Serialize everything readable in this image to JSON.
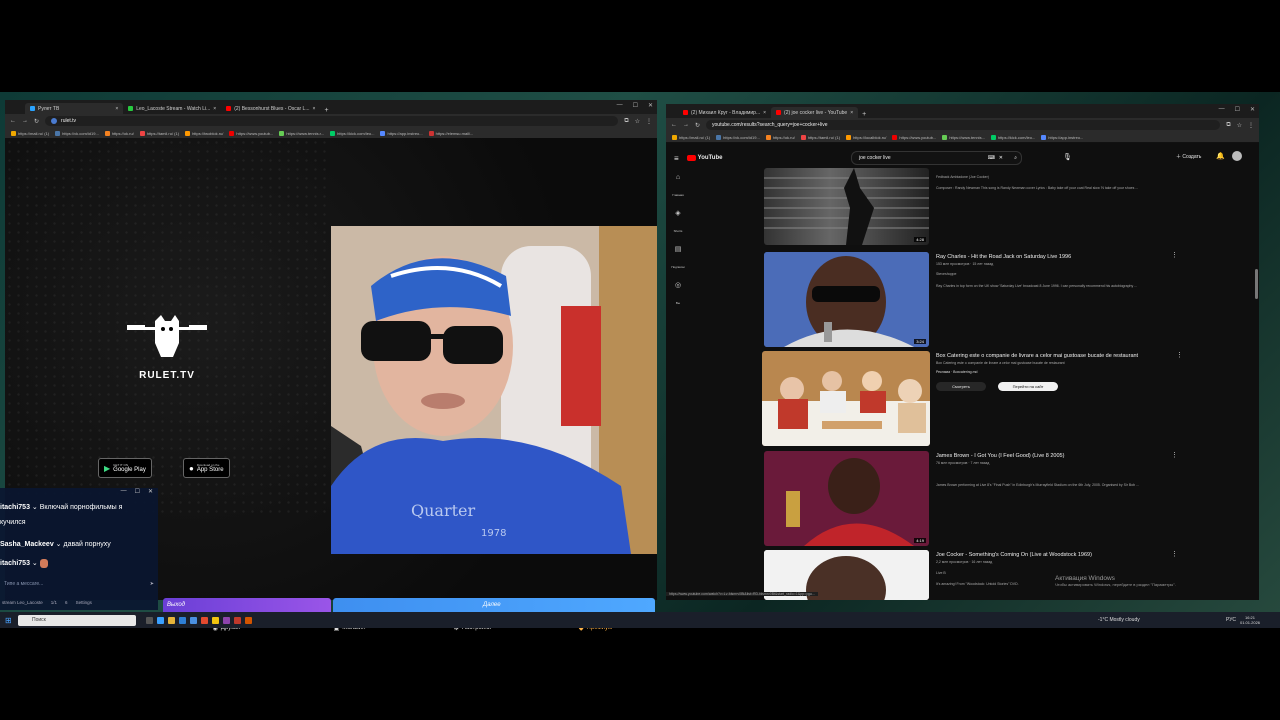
{
  "left_browser": {
    "tabs": [
      {
        "label": "Рулет ТВ",
        "color": "#2aa3ff"
      },
      {
        "label": "Leo_Lacoste Stream - Watch Li...",
        "color": "#27c93f"
      },
      {
        "label": "(2) Bessonhurst Blues - Oscar L...",
        "color": "#ff0000"
      }
    ],
    "url": "rulet.tv",
    "bookmarks": [
      "https://mail.ru/ (1)",
      "https://vk.com/id19...",
      "https://ok.ru/",
      "https://tamil.ru/ (1)",
      "https://twoblok.ru/",
      "https://www.youtub...",
      "https://www.tennis.r...",
      "https://kick.com/leo...",
      "https://app.instreo...",
      "https://elemsu.mail/..."
    ]
  },
  "rulet": {
    "logo_text": "RULET.TV",
    "google_play_small": "GET IT ON",
    "google_play": "Google Play",
    "app_store_small": "Download on the",
    "app_store": "App Store",
    "btn_left": "Выход",
    "btn_right": "Далее",
    "nav": [
      {
        "label": "Друзья",
        "icon": "friends-icon"
      },
      {
        "label": "Магазин",
        "icon": "shop-icon"
      },
      {
        "label": "Настройки",
        "icon": "gear-icon"
      },
      {
        "label": "Премиум",
        "icon": "premium-icon"
      }
    ]
  },
  "chat": {
    "messages": [
      {
        "nick": "itachi753",
        "text": "Включай порнофильмы я",
        "cont": "кучился"
      },
      {
        "nick": "Sasha_Mackeev",
        "text": "давай порнуху",
        "cont": ""
      },
      {
        "nick": "itachi753",
        "text": "",
        "cont": ""
      }
    ],
    "input_placeholder": "Типе а мессаге...",
    "footer_stream": "stream Leo_Lacoste",
    "footer_count": "1/1",
    "footer_viewers": "6",
    "footer_settings": "Settings"
  },
  "right_browser": {
    "tabs": [
      {
        "label": "(2) Михаил Круг - Владимир...",
        "color": "#ff0000"
      },
      {
        "label": "(2) joe cocker live - YouTube",
        "color": "#ff0000"
      }
    ],
    "url": "youtube.com/results?search_query=joe+cocker+live",
    "bookmarks": [
      "https://mail.ru/ (1)",
      "https://vk.com/id19...",
      "https://ok.ru/",
      "https://tamil.ru/ (1)",
      "https://localblok.ru/",
      "https://www.youtub...",
      "https://www.tennis...",
      "https://kick.com/leo...",
      "https://app.instreo..."
    ],
    "status_url": "https://www.youtube.com/watch?v=Lv-fdsmrv0Bt&list=RD-fdsmrv0Bt&start_radio=1&pp=ygu..."
  },
  "youtube": {
    "logo": "YouTube",
    "search": "joe cocker live",
    "create": "Создать",
    "sidebar": [
      "Главная",
      "Shorts",
      "Подписки",
      "Вы"
    ],
    "results": [
      {
        "title": "",
        "meta": "Fedback Ambiadone (Joe Cocker)",
        "desc": "Composer : Randy Newman This song is Randy Newman cover Lyrics : Baby take off your coat Real slow 'N take off your shoes ...",
        "duration": "4:28"
      },
      {
        "title": "Ray Charles - Hit the Road Jack on Saturday Live 1996",
        "meta": "153 млн просмотров · 15 лет назад",
        "channel": "Steveshoppe",
        "desc": "Ray Charles in top form on the UK show 'Saturday Live' broadcast 8 June 1996. I can personally recommend his autobiography ...",
        "duration": "3:24"
      },
      {
        "title": "Box Catering este o companie de livrare a celor mai gustoase bucate de restaurant",
        "meta": "Box Catering este o companie de livrare a celor mai gustoase bucate de restaurant",
        "channel": "Реклама · Boxcatering.md",
        "btn1": "Смотреть",
        "btn2": "Перейти на сайт"
      },
      {
        "title": "James Brown - I Got You (I Feel Good) (Live 8 2005)",
        "meta": "76 млн просмотров · 7 лет назад",
        "desc": "James Brown performing at Live 8's \"Final Push\" in Edinburgh's Murrayfield Stadium on the 6th July, 2005. Organised by Sir Bob ...",
        "duration": "4:19"
      },
      {
        "title": "Joe Cocker - Something's Coming On (Live at Woodstock 1969)",
        "meta": "2,2 млн просмотров · 16 лет назад",
        "channel": "Live B",
        "desc": "It's amazing! From \"Woodstock: Untold Stories\" DVD."
      }
    ],
    "activation_title": "Активация Windows",
    "activation_text": "Чтобы активировать Windows, перейдите в раздел \"Параметры\"."
  },
  "taskbar": {
    "search": "Поиск",
    "weather": "-1°C  Mostly cloudy",
    "lang": "РУС",
    "time": "16:21",
    "date": "01.01.2026"
  }
}
